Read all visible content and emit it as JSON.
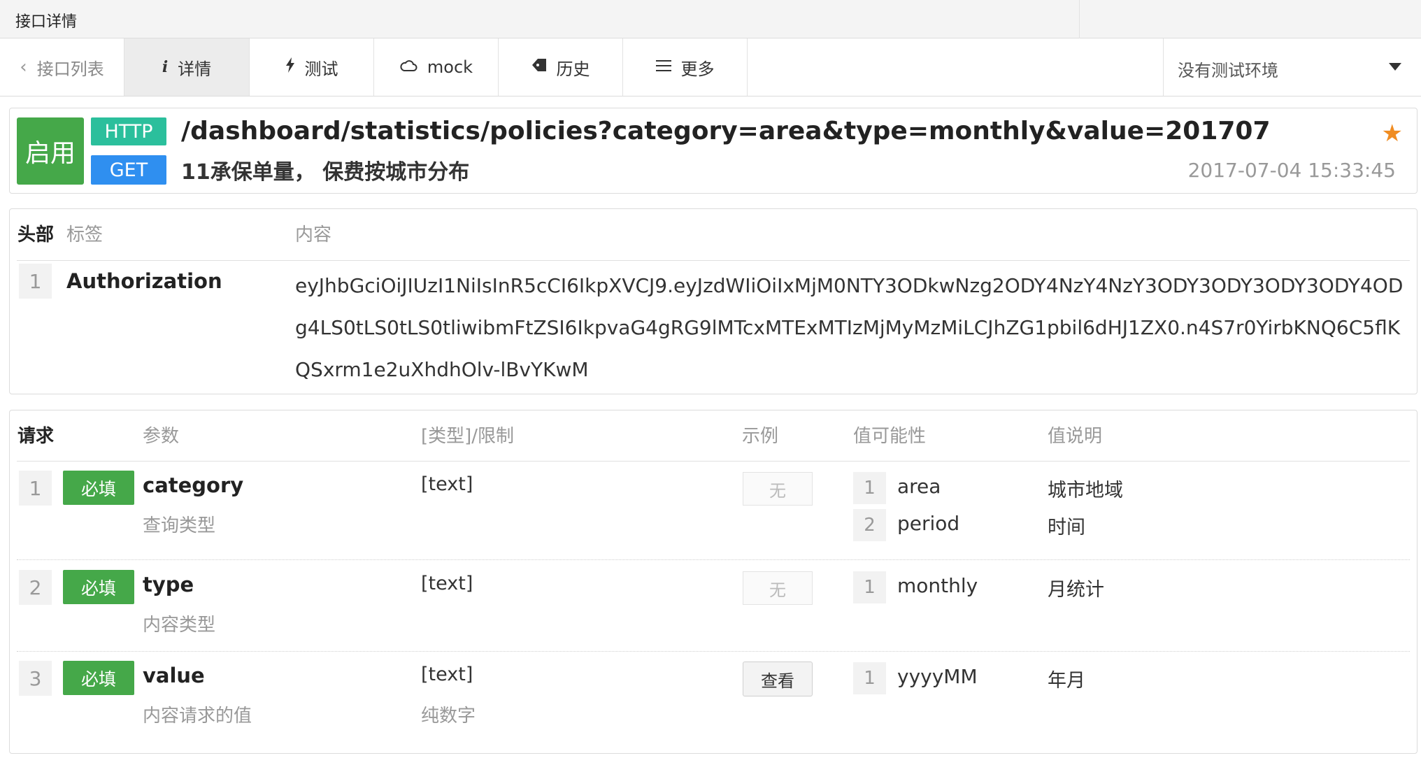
{
  "window": {
    "title": "接口详情"
  },
  "tabs": {
    "back": "接口列表",
    "detail": "详情",
    "test": "测试",
    "mock": "mock",
    "history": "历史",
    "more": "更多",
    "env": "没有测试环境"
  },
  "api": {
    "status": "启用",
    "protocol": "HTTP",
    "method": "GET",
    "path": "/dashboard/statistics/policies?category=area&type=monthly&value=201707",
    "description": "11承保单量， 保费按城市分布",
    "updated": "2017-07-04 15:33:45",
    "colors": {
      "enabled": "#45a849",
      "protocol": "#2bbf9c",
      "method": "#2f8ff0",
      "star": "#f08c22"
    }
  },
  "headers": {
    "section": "头部",
    "col_tag": "标签",
    "col_content": "内容",
    "rows": [
      {
        "num": "1",
        "name": "Authorization",
        "value": "eyJhbGciOiJIUzI1NiIsInR5cCI6IkpXVCJ9.eyJzdWIiOiIxMjM0NTY3ODkwNzg2ODY4NzY4NzY3ODY3ODY3ODY3ODY4ODg4LS0tLS0tLS0tliwibmFtZSI6IkpvaG4gRG9lMTcxMTExMTIzMjMyMzMiLCJhZG1pbil6dHJ1ZX0.n4S7r0YirbKNQ6C5flKQSxrm1e2uXhdhOlv-lBvYKwM"
      }
    ]
  },
  "request": {
    "section": "请求",
    "col_param": "参数",
    "col_type": "[类型]/限制",
    "col_example": "示例",
    "col_values": "值可能性",
    "col_value_desc": "值说明",
    "params": [
      {
        "num": "1",
        "required": "必填",
        "name": "category",
        "desc": "查询类型",
        "type": "[text]",
        "limit": "",
        "example": "无",
        "values": [
          {
            "num": "1",
            "value": "area",
            "desc": "城市地域"
          },
          {
            "num": "2",
            "value": "period",
            "desc": "时间"
          }
        ]
      },
      {
        "num": "2",
        "required": "必填",
        "name": "type",
        "desc": "内容类型",
        "type": "[text]",
        "limit": "",
        "example": "无",
        "values": [
          {
            "num": "1",
            "value": "monthly",
            "desc": "月统计"
          }
        ]
      },
      {
        "num": "3",
        "required": "必填",
        "name": "value",
        "desc": "内容请求的值",
        "type": "[text]",
        "limit": "纯数字",
        "example": "查看",
        "values": [
          {
            "num": "1",
            "value": "yyyyMM",
            "desc": "年月"
          }
        ]
      }
    ]
  }
}
